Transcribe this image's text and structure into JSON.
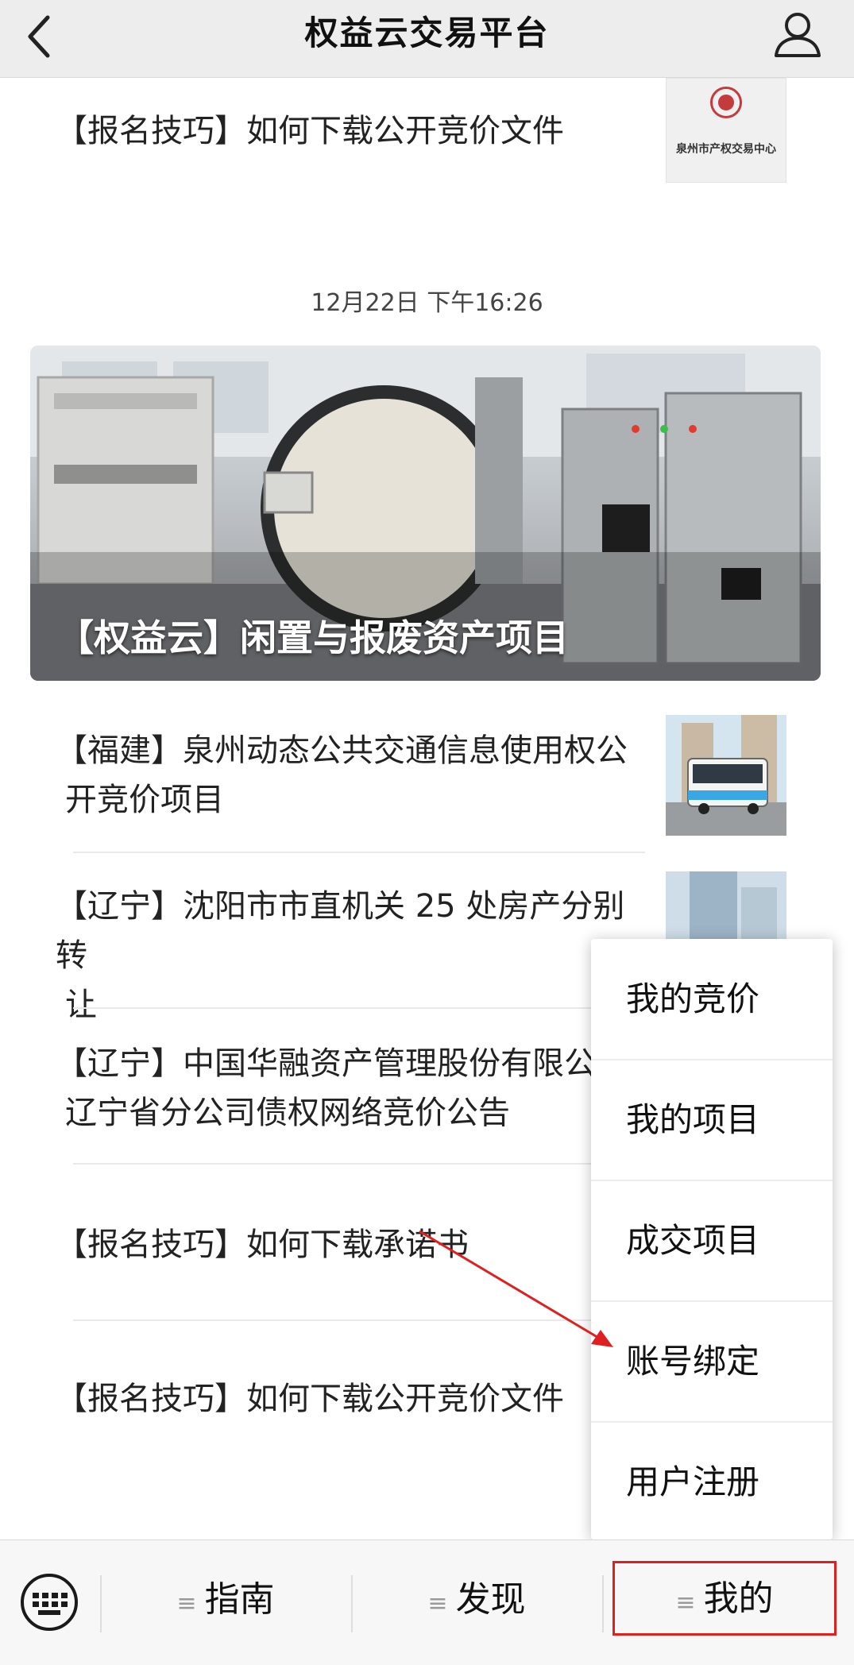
{
  "header": {
    "title": "权益云交易平台"
  },
  "top_article": {
    "title": "【报名技巧】如何下载公开竞价文件",
    "thumb_logo_text": "泉州市产权交易中心"
  },
  "timestamp": "12月22日 下午16:26",
  "banner": {
    "title": "【权益云】闲置与报废资产项目"
  },
  "news": [
    {
      "line1": "【福建】泉州动态公共交通信息使用权公",
      "line2": "开竞价项目"
    },
    {
      "line1": "【辽宁】沈阳市市直机关 25 处房产分别转",
      "line2": "让"
    },
    {
      "line1": "【辽宁】中国华融资产管理股份有限公",
      "line2": "辽宁省分公司债权网络竞价公告"
    },
    {
      "line1": "【报名技巧】如何下载承诺书",
      "line2": ""
    },
    {
      "line1": "【报名技巧】如何下载公开竞价文件",
      "line2": ""
    }
  ],
  "popup_menu": {
    "items": [
      "我的竞价",
      "我的项目",
      "成交项目",
      "账号绑定",
      "用户注册"
    ]
  },
  "bottom_bar": {
    "menu_glyph": "≡",
    "tabs": [
      "指南",
      "发现",
      "我的"
    ]
  },
  "colors": {
    "highlight": "#e02020",
    "header_bg": "#ededed"
  }
}
